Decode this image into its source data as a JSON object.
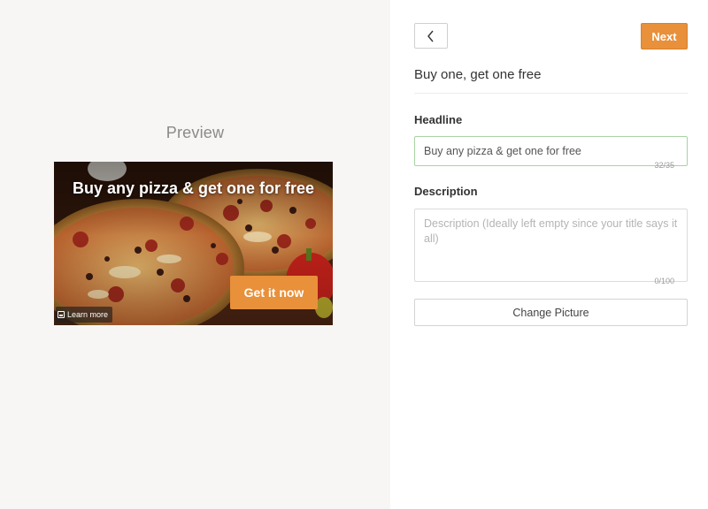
{
  "preview": {
    "title": "Preview",
    "ad": {
      "headline": "Buy any pizza & get one for free",
      "cta_label": "Get it now",
      "learn_more_label": "Learn more",
      "image_icon": "photo-pizza",
      "cta_color": "#e8903a"
    }
  },
  "editor": {
    "back_icon": "chevron-left-icon",
    "next_label": "Next",
    "campaign_title": "Buy one, get one free",
    "headline": {
      "label": "Headline",
      "value": "Buy any pizza & get one for free",
      "counter": "32/35"
    },
    "description": {
      "label": "Description",
      "value": "",
      "placeholder": "Description (Ideally left empty since your title says it all)",
      "counter": "0/100"
    },
    "change_picture_label": "Change Picture"
  },
  "colors": {
    "accent": "#e8903a",
    "valid_border": "#a9d3a3",
    "left_bg": "#f7f6f4"
  }
}
